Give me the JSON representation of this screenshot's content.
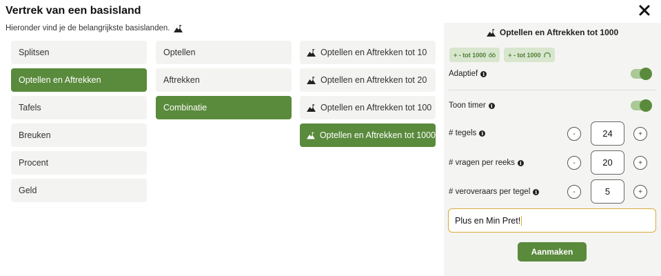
{
  "dialog": {
    "title": "Vertrek van een basisland",
    "subtitle": "Hieronder vind je de belangrijkste basislanden."
  },
  "columns": {
    "categories": [
      "Splitsen",
      "Optellen en Aftrekken",
      "Tafels",
      "Breuken",
      "Procent",
      "Geld"
    ],
    "categories_selected": "Optellen en Aftrekken",
    "subcategories": [
      "Optellen",
      "Aftrekken",
      "Combinatie"
    ],
    "subcategories_selected": "Combinatie",
    "levels": [
      "Optellen en Aftrekken tot 10",
      "Optellen en Aftrekken tot 20",
      "Optellen en Aftrekken tot 100",
      "Optellen en Aftrekken tot 1000"
    ],
    "levels_selected": "Optellen en Aftrekken tot 1000"
  },
  "panel": {
    "title": "Optellen en Aftrekken tot 1000",
    "tags": [
      "+ - tot 1000",
      "+ - tot 1000"
    ],
    "adaptive_label": "Adaptief",
    "adaptive_on": true,
    "timer_label": "Toon timer",
    "timer_on": true,
    "tiles_label": "# tegels",
    "tiles_value": "24",
    "questions_label": "# vragen per reeks",
    "questions_value": "20",
    "conquerors_label": "# veroveraars per tegel",
    "conquerors_value": "5",
    "minus_label": "-",
    "plus_label": "+",
    "name_value": "Plus en Min Pret!",
    "create_label": "Aanmaken"
  },
  "colors": {
    "accent": "#5a8a3c",
    "panel_bg": "#f4f4f2",
    "focus": "#d9a93a"
  }
}
